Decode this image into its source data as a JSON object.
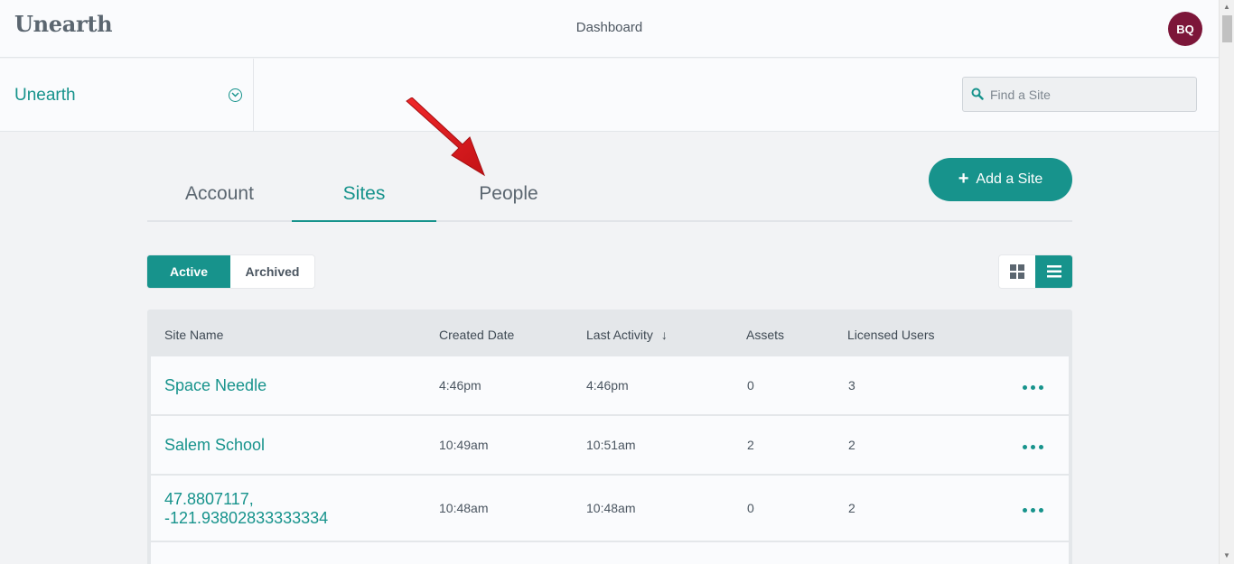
{
  "app": {
    "logo": "Unearth",
    "page_title": "Dashboard",
    "user_initials": "BQ"
  },
  "subheader": {
    "org_name": "Unearth",
    "search_placeholder": "Find a Site"
  },
  "tabs": [
    {
      "label": "Account"
    },
    {
      "label": "Sites"
    },
    {
      "label": "People"
    }
  ],
  "add_button_label": "Add a Site",
  "filters": {
    "active": "Active",
    "archived": "Archived"
  },
  "table": {
    "headers": {
      "name": "Site Name",
      "created": "Created Date",
      "activity": "Last Activity",
      "assets": "Assets",
      "users": "Licensed Users"
    },
    "rows": [
      {
        "name": "Space Needle",
        "created": "4:46pm",
        "activity": "4:46pm",
        "assets": "0",
        "users": "3"
      },
      {
        "name": "Salem School",
        "created": "10:49am",
        "activity": "10:51am",
        "assets": "2",
        "users": "2"
      },
      {
        "name": "47.8807117, -121.93802833333334",
        "name_line1": "47.8807117,",
        "name_line2": "-121.93802833333334",
        "created": "10:48am",
        "activity": "10:48am",
        "assets": "0",
        "users": "2"
      }
    ]
  },
  "colors": {
    "accent": "#17938c",
    "avatar": "#7c1639",
    "arrow": "#d9191c"
  }
}
